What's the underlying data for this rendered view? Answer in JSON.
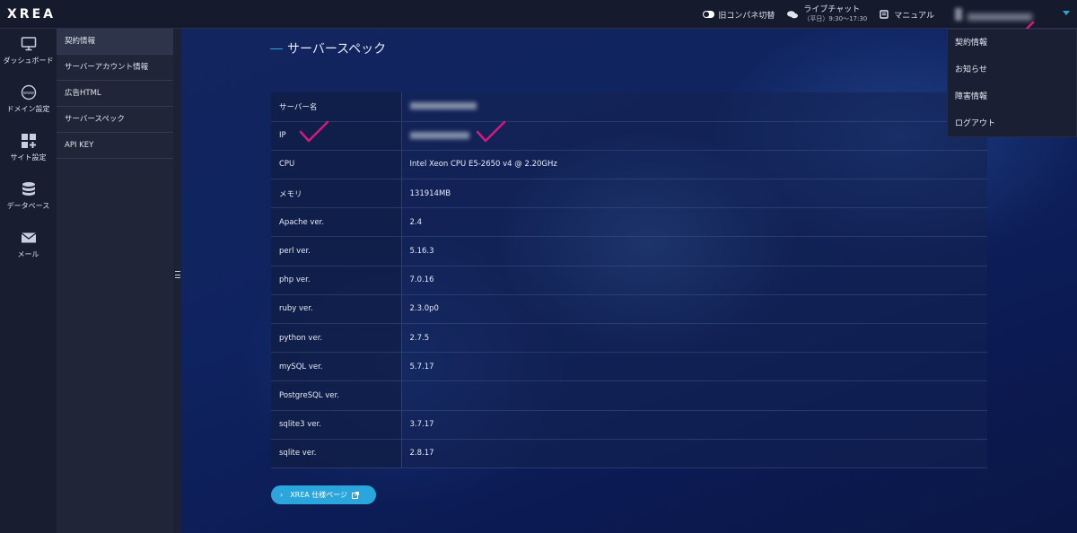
{
  "app": {
    "logo": "XREA"
  },
  "topbar": {
    "toggle_label": "旧コンパネ切替",
    "chat_label": "ライブチャット",
    "chat_hours": "（平日）9:30〜17:30",
    "manual_label": "マニュアル"
  },
  "user_menu": {
    "items": [
      {
        "label": "契約情報"
      },
      {
        "label": "お知らせ"
      },
      {
        "label": "障害情報"
      },
      {
        "label": "ログアウト"
      }
    ]
  },
  "rail": {
    "items": [
      {
        "label": "ダッシュボード",
        "icon": "monitor-icon"
      },
      {
        "label": "ドメイン設定",
        "icon": "www-icon"
      },
      {
        "label": "サイト設定",
        "icon": "grid-plus-icon"
      },
      {
        "label": "データベース",
        "icon": "database-icon"
      },
      {
        "label": "メール",
        "icon": "mail-icon"
      }
    ]
  },
  "submenu": {
    "items": [
      {
        "label": "契約情報",
        "active": true
      },
      {
        "label": "サーバーアカウント情報"
      },
      {
        "label": "広告HTML"
      },
      {
        "label": "サーバースペック"
      },
      {
        "label": "API KEY"
      }
    ]
  },
  "main": {
    "title": "サーバースペック",
    "specs": [
      {
        "label": "サーバー名",
        "value": ""
      },
      {
        "label": "IP",
        "value": ""
      },
      {
        "label": "CPU",
        "value": "Intel Xeon CPU E5-2650 v4 @ 2.20GHz"
      },
      {
        "label": "メモリ",
        "value": "131914MB"
      },
      {
        "label": "Apache ver.",
        "value": "2.4"
      },
      {
        "label": "perl ver.",
        "value": "5.16.3"
      },
      {
        "label": "php ver.",
        "value": "7.0.16"
      },
      {
        "label": "ruby ver.",
        "value": "2.3.0p0"
      },
      {
        "label": "python ver.",
        "value": "2.7.5"
      },
      {
        "label": "mySQL ver.",
        "value": "5.7.17"
      },
      {
        "label": "PostgreSQL ver.",
        "value": ""
      },
      {
        "label": "sqlite3 ver.",
        "value": "3.7.17"
      },
      {
        "label": "sqlite ver.",
        "value": "2.8.17"
      }
    ],
    "spec_button_label": "XREA 仕様ページ"
  },
  "colors": {
    "accent": "#2aa6dc",
    "checkmark": "#d6197a",
    "topbar": "#151a2c"
  }
}
